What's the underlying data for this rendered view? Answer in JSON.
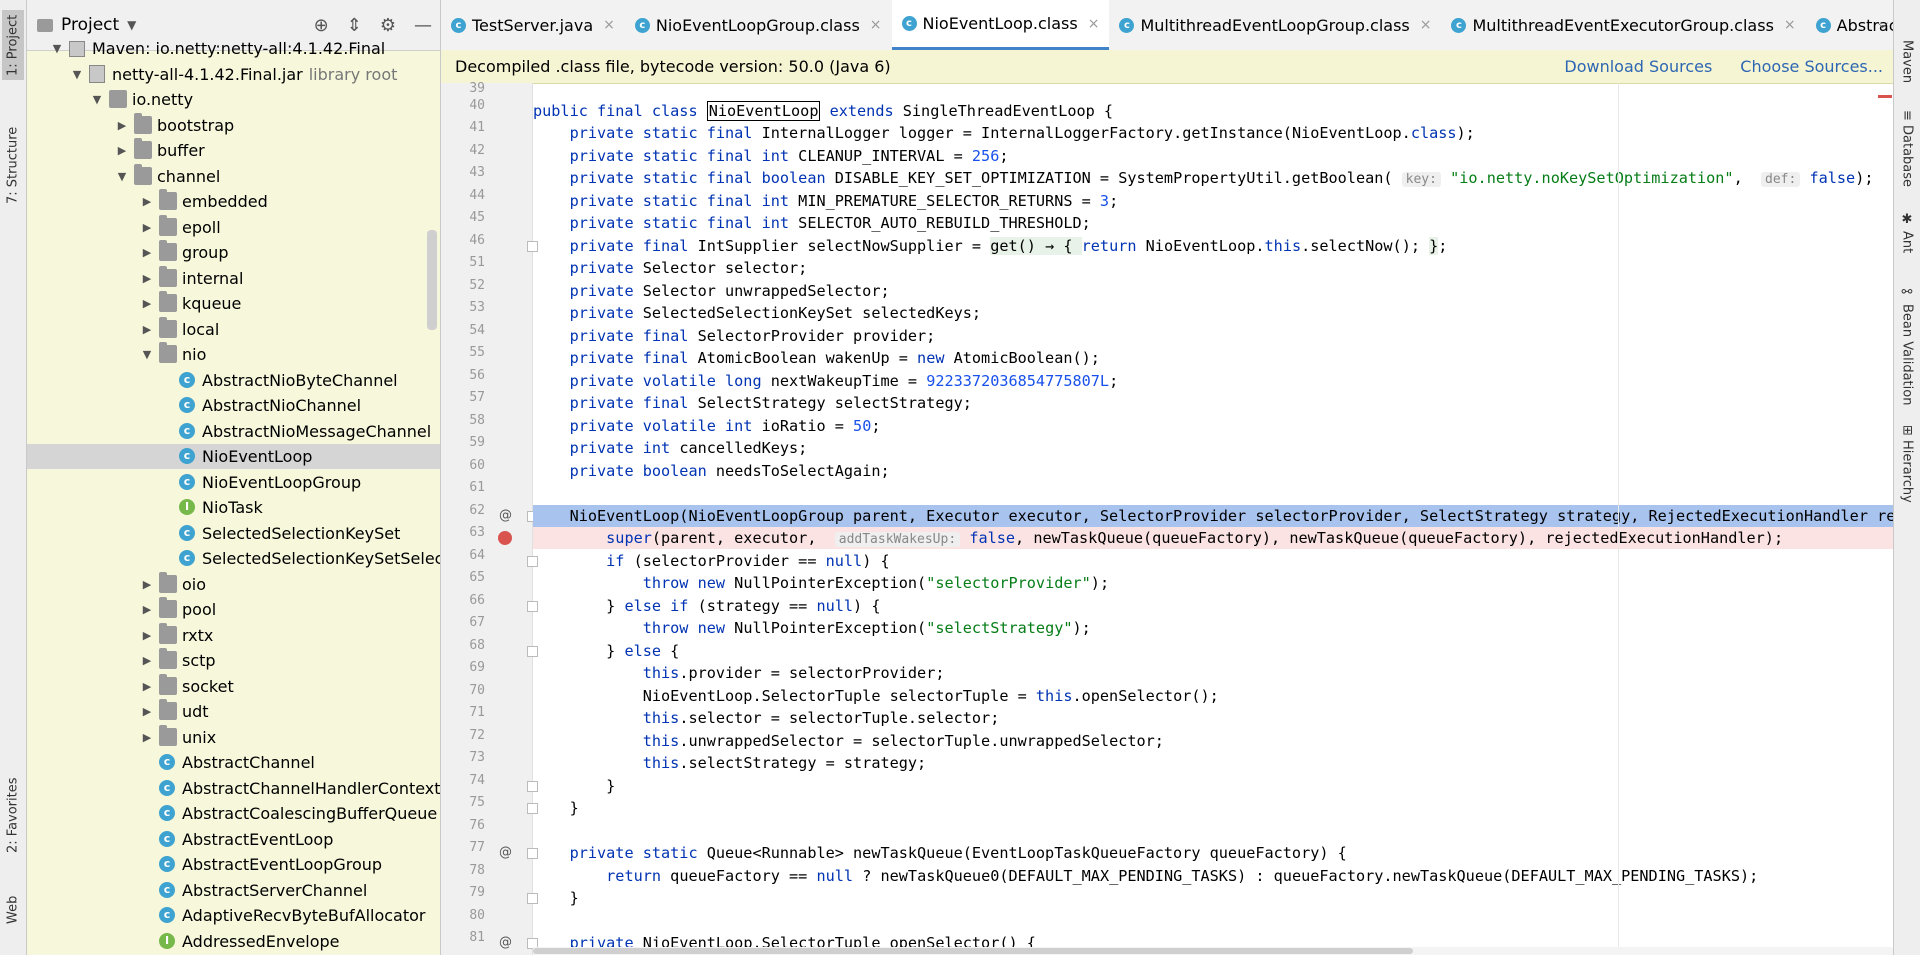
{
  "left_strip": {
    "tabs": [
      {
        "label": "1: Project"
      },
      {
        "label": "7: Structure"
      },
      {
        "label": "2: Favorites"
      },
      {
        "label": "Web"
      }
    ]
  },
  "right_strip": {
    "tabs": [
      {
        "label": "Maven"
      },
      {
        "label": "Database"
      },
      {
        "label": "Ant"
      },
      {
        "label": "Bean Validation"
      },
      {
        "label": "Hierarchy"
      }
    ]
  },
  "project": {
    "title": "Project",
    "tree": [
      {
        "label": "Maven: io.netty:netty-all:4.1.42.Final",
        "sub": "",
        "type": "maven",
        "arrow": "▼"
      },
      {
        "label": "netty-all-4.1.42.Final.jar",
        "sub": "library root",
        "type": "jar",
        "arrow": "▼"
      },
      {
        "label": "io.netty",
        "sub": "",
        "type": "pkg",
        "arrow": "▼"
      },
      {
        "label": "bootstrap",
        "sub": "",
        "type": "folder",
        "arrow": "▶"
      },
      {
        "label": "buffer",
        "sub": "",
        "type": "folder",
        "arrow": "▶"
      },
      {
        "label": "channel",
        "sub": "",
        "type": "folder",
        "arrow": "▼"
      },
      {
        "label": "embedded",
        "sub": "",
        "type": "folder",
        "arrow": "▶"
      },
      {
        "label": "epoll",
        "sub": "",
        "type": "folder",
        "arrow": "▶"
      },
      {
        "label": "group",
        "sub": "",
        "type": "folder",
        "arrow": "▶"
      },
      {
        "label": "internal",
        "sub": "",
        "type": "folder",
        "arrow": "▶"
      },
      {
        "label": "kqueue",
        "sub": "",
        "type": "folder",
        "arrow": "▶"
      },
      {
        "label": "local",
        "sub": "",
        "type": "folder",
        "arrow": "▶"
      },
      {
        "label": "nio",
        "sub": "",
        "type": "folder",
        "arrow": "▼"
      },
      {
        "label": "AbstractNioByteChannel",
        "sub": "",
        "type": "cls",
        "arrow": ""
      },
      {
        "label": "AbstractNioChannel",
        "sub": "",
        "type": "cls",
        "arrow": ""
      },
      {
        "label": "AbstractNioMessageChannel",
        "sub": "",
        "type": "cls",
        "arrow": ""
      },
      {
        "label": "NioEventLoop",
        "sub": "",
        "type": "cls",
        "arrow": ""
      },
      {
        "label": "NioEventLoopGroup",
        "sub": "",
        "type": "cls",
        "arrow": ""
      },
      {
        "label": "NioTask",
        "sub": "",
        "type": "iface",
        "arrow": ""
      },
      {
        "label": "SelectedSelectionKeySet",
        "sub": "",
        "type": "cls",
        "arrow": ""
      },
      {
        "label": "SelectedSelectionKeySetSelect",
        "sub": "",
        "type": "cls",
        "arrow": ""
      },
      {
        "label": "oio",
        "sub": "",
        "type": "folder",
        "arrow": "▶"
      },
      {
        "label": "pool",
        "sub": "",
        "type": "folder",
        "arrow": "▶"
      },
      {
        "label": "rxtx",
        "sub": "",
        "type": "folder",
        "arrow": "▶"
      },
      {
        "label": "sctp",
        "sub": "",
        "type": "folder",
        "arrow": "▶"
      },
      {
        "label": "socket",
        "sub": "",
        "type": "folder",
        "arrow": "▶"
      },
      {
        "label": "udt",
        "sub": "",
        "type": "folder",
        "arrow": "▶"
      },
      {
        "label": "unix",
        "sub": "",
        "type": "folder",
        "arrow": "▶"
      },
      {
        "label": "AbstractChannel",
        "sub": "",
        "type": "cls",
        "arrow": ""
      },
      {
        "label": "AbstractChannelHandlerContext",
        "sub": "",
        "type": "cls",
        "arrow": ""
      },
      {
        "label": "AbstractCoalescingBufferQueue",
        "sub": "",
        "type": "cls",
        "arrow": ""
      },
      {
        "label": "AbstractEventLoop",
        "sub": "",
        "type": "cls",
        "arrow": ""
      },
      {
        "label": "AbstractEventLoopGroup",
        "sub": "",
        "type": "cls",
        "arrow": ""
      },
      {
        "label": "AbstractServerChannel",
        "sub": "",
        "type": "cls",
        "arrow": ""
      },
      {
        "label": "AdaptiveRecvByteBufAllocator",
        "sub": "",
        "type": "cls",
        "arrow": ""
      },
      {
        "label": "AddressedEnvelope",
        "sub": "",
        "type": "iface",
        "arrow": ""
      }
    ]
  },
  "editor": {
    "tabs": [
      {
        "label": "TestServer.java",
        "active": false
      },
      {
        "label": "NioEventLoopGroup.class",
        "active": false
      },
      {
        "label": "NioEventLoop.class",
        "active": true
      },
      {
        "label": "MultithreadEventLoopGroup.class",
        "active": false
      },
      {
        "label": "MultithreadEventExecutorGroup.class",
        "active": false
      },
      {
        "label": "AbstractEventl",
        "active": false
      }
    ],
    "banner": {
      "message": "Decompiled .class file, bytecode version: 50.0 (Java 6)",
      "download": "Download Sources",
      "choose": "Choose Sources..."
    },
    "line_numbers": [
      "39",
      "40",
      "41",
      "42",
      "43",
      "44",
      "45",
      "46",
      "51",
      "52",
      "53",
      "54",
      "55",
      "56",
      "57",
      "58",
      "59",
      "60",
      "61",
      "62",
      "63",
      "64",
      "65",
      "66",
      "67",
      "68",
      "69",
      "70",
      "71",
      "72",
      "73",
      "74",
      "75",
      "76",
      "77",
      "78",
      "79",
      "80",
      "81"
    ],
    "code": {
      "hint_key": "key:",
      "hint_def": "def:",
      "hint_addTask": "addTaskWakesUp:",
      "noKeySet": "\"io.netty.noKeySetOptimization\"",
      "selectorProviderStr": "\"selectorProvider\"",
      "selectStrategyStr": "\"selectStrategy\"",
      "cleanupInterval": "256",
      "minPremature": "3",
      "nextWakeup": "9223372036854775807L",
      "ioRatio": "50"
    }
  },
  "colors": {
    "keyword": "#0033b3",
    "string": "#067d17",
    "number": "#1750eb",
    "selection": "#a8c4ee",
    "breakpoint_line": "#fbe3e4",
    "panel_bg": "#f7f7dc"
  }
}
